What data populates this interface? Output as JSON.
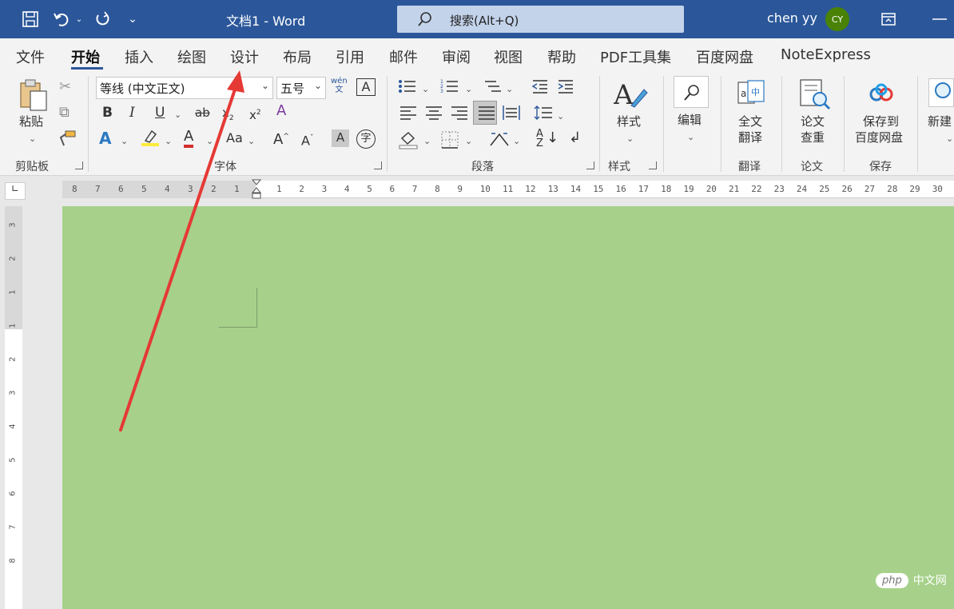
{
  "titlebar": {
    "doc_title": "文档1  -  Word",
    "search_label": "搜索(Alt+Q)",
    "user_name": "chen yy",
    "avatar_initials": "CY",
    "bg_color": "#2b579a"
  },
  "menu": {
    "tabs": [
      "文件",
      "开始",
      "插入",
      "绘图",
      "设计",
      "布局",
      "引用",
      "邮件",
      "审阅",
      "视图",
      "帮助",
      "PDF工具集",
      "百度网盘",
      "NoteExpress"
    ],
    "active": "开始"
  },
  "ribbon": {
    "clipboard": {
      "paste": "粘贴",
      "group": "剪贴板"
    },
    "font": {
      "name": "等线 (中文正文)",
      "size": "五号",
      "group": "字体"
    },
    "paragraph": {
      "group": "段落"
    },
    "styles": {
      "label": "样式",
      "group": "样式"
    },
    "editing": {
      "label": "编辑"
    },
    "translate": {
      "label1": "全文",
      "label2": "翻译",
      "group": "翻译"
    },
    "paper": {
      "label1": "论文",
      "label2": "查重",
      "group": "论文"
    },
    "save": {
      "label1": "保存到",
      "label2": "百度网盘",
      "group": "保存"
    },
    "new": {
      "label": "新建"
    }
  },
  "ruler": {
    "left_numbers": [
      "8",
      "7",
      "6",
      "5",
      "4",
      "3",
      "2",
      "1"
    ],
    "right_numbers": [
      "1",
      "2",
      "3",
      "4",
      "5",
      "6",
      "7",
      "8",
      "9",
      "10",
      "11",
      "12",
      "13",
      "14",
      "15",
      "16",
      "17",
      "18",
      "19",
      "20",
      "21",
      "22",
      "23",
      "24",
      "25",
      "26",
      "27",
      "28",
      "29",
      "30"
    ],
    "vertical_numbers": [
      "3",
      "2",
      "1",
      "1",
      "2",
      "3",
      "4",
      "5",
      "6",
      "7",
      "8"
    ]
  },
  "page": {
    "bg_color": "#a7d18a"
  },
  "annotation": {
    "arrow_color": "#e53935",
    "target": "设计"
  },
  "watermark": {
    "logo": "php",
    "text": "中文网"
  }
}
